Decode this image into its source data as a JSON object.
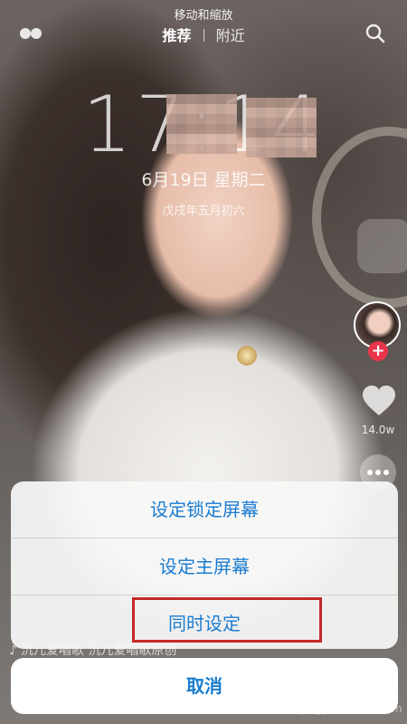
{
  "header": {
    "title": "移动和缩放",
    "tabs": [
      {
        "label": "推荐",
        "active": true
      },
      {
        "label": "附近",
        "active": false
      }
    ],
    "left_icon": "dots-icon",
    "right_icon": "search-icon"
  },
  "lock_screen": {
    "time": "17:14",
    "date": "6月19日  星期二",
    "lunar_date": "戊戌年五月初六"
  },
  "side_panel": {
    "like_count": "14.0w",
    "icons": [
      "avatar",
      "plus-icon",
      "heart-icon",
      "more-icon"
    ]
  },
  "music": {
    "text": "沉儿爱唱歌   沉儿爱唱歌原创",
    "icon": "music-note-icon"
  },
  "action_sheet": {
    "items": [
      {
        "label": "设定锁定屏幕"
      },
      {
        "label": "设定主屏幕"
      },
      {
        "label": "同时设定",
        "highlighted": true
      }
    ],
    "cancel_label": "取消",
    "accent_color": "#1a7cd0",
    "highlight_color": "#c62828"
  },
  "watermark": {
    "text": "Bai 经验",
    "sub": "jingyan.baidu.com"
  }
}
